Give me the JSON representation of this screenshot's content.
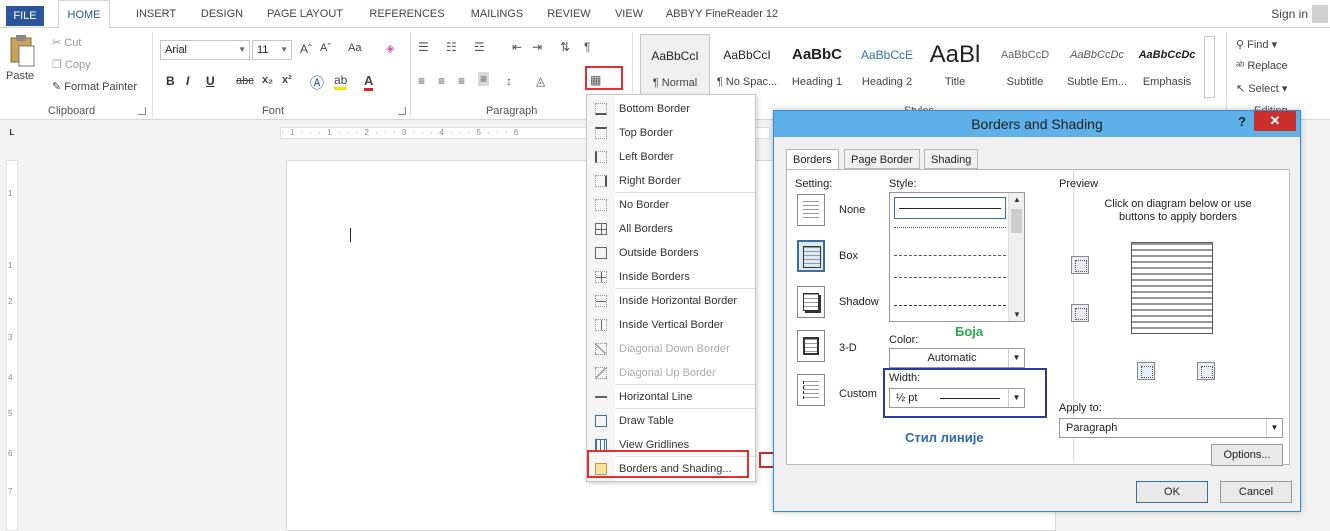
{
  "tabs": {
    "file": "FILE",
    "home": "HOME",
    "insert": "INSERT",
    "design": "DESIGN",
    "page_layout": "PAGE LAYOUT",
    "references": "REFERENCES",
    "mailings": "MAILINGS",
    "review": "REVIEW",
    "view": "VIEW",
    "abbyy": "ABBYY FineReader 12",
    "sign_in": "Sign in"
  },
  "clipboard": {
    "paste": "Paste",
    "cut": "Cut",
    "copy": "Copy",
    "format_painter": "Format Painter",
    "label": "Clipboard"
  },
  "font": {
    "family": "Arial",
    "size": "11",
    "label": "Font",
    "grow": "Aˆ",
    "shrink": "Aˇ",
    "case": "Aa",
    "bold": "B",
    "italic": "I",
    "underline": "U",
    "strike": "abc",
    "subscript": "x₂",
    "superscript": "x²"
  },
  "paragraph": {
    "label": "Paragraph",
    "pilcrow": "¶"
  },
  "styles": {
    "label": "Styles",
    "items": [
      {
        "sample": "AaBbCcI",
        "name": "¶ Normal"
      },
      {
        "sample": "AaBbCcI",
        "name": "¶ No Spac..."
      },
      {
        "sample": "AaBbC",
        "name": "Heading 1"
      },
      {
        "sample": "AaBbCcE",
        "name": "Heading 2"
      },
      {
        "sample": "AaBl",
        "name": "Title"
      },
      {
        "sample": "AaBbCcD",
        "name": "Subtitle"
      },
      {
        "sample": "AaBbCcDc",
        "name": "Subtle Em..."
      },
      {
        "sample": "AaBbCcDc",
        "name": "Emphasis"
      }
    ]
  },
  "editing": {
    "find": "Find",
    "replace": "Replace",
    "select": "Select",
    "label": "Editing"
  },
  "ruler": {
    "corner": "L",
    "ticks": "· 1 · · · 1 · · · 2 · · · 3 · · · 4 · · · 5 · · · 6",
    "vertical": [
      "1",
      "1",
      "2",
      "3",
      "4",
      "5",
      "6",
      "7"
    ]
  },
  "border_menu": {
    "items": [
      "Bottom Border",
      "Top Border",
      "Left Border",
      "Right Border",
      "No Border",
      "All Borders",
      "Outside Borders",
      "Inside Borders",
      "Inside Horizontal Border",
      "Inside Vertical Border",
      "Diagonal Down Border",
      "Diagonal Up Border",
      "Horizontal Line",
      "Draw Table",
      "View Gridlines",
      "Borders and Shading..."
    ]
  },
  "dialog": {
    "title": "Borders and Shading",
    "help": "?",
    "close": "✕",
    "tabs": [
      "Borders",
      "Page Border",
      "Shading"
    ],
    "setting_label": "Setting:",
    "settings": [
      "None",
      "Box",
      "Shadow",
      "3-D",
      "Custom"
    ],
    "style_label": "Style:",
    "color_label": "Color:",
    "color_value": "Automatic",
    "width_label": "Width:",
    "width_value": "½ pt",
    "preview_label": "Preview",
    "preview_hint": "Click on diagram below or use buttons to apply borders",
    "apply_label": "Apply to:",
    "apply_value": "Paragraph",
    "options": "Options...",
    "ok": "OK",
    "cancel": "Cancel"
  },
  "annotations": {
    "color": "Боја",
    "line_style": "Стил линије"
  }
}
